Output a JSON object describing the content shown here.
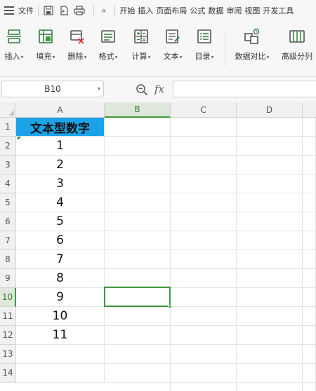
{
  "menubar": {
    "file_label": "文件",
    "tabs": [
      "开始",
      "插入",
      "页面布局",
      "公式",
      "数据",
      "审阅",
      "视图",
      "开发工具"
    ],
    "more_glyph": "»"
  },
  "ribbon": {
    "buttons": [
      {
        "label": "插入",
        "icon": "insert-icon"
      },
      {
        "label": "填充",
        "icon": "fill-icon"
      },
      {
        "label": "删除",
        "icon": "delete-icon"
      },
      {
        "label": "格式",
        "icon": "format-icon"
      },
      {
        "label": "计算",
        "icon": "calculate-icon"
      },
      {
        "label": "文本",
        "icon": "text-icon"
      },
      {
        "label": "目录",
        "icon": "catalog-icon"
      },
      {
        "label": "数据对比",
        "icon": "data-compare-icon"
      },
      {
        "label": "高级分列",
        "icon": "advanced-split-icon"
      }
    ],
    "caret": "▾"
  },
  "formula_bar": {
    "name_box": "B10",
    "fx_label": "fx",
    "value": ""
  },
  "grid": {
    "columns": [
      "A",
      "B",
      "C",
      "D"
    ],
    "selected_column": "B",
    "rows": [
      "1",
      "2",
      "3",
      "4",
      "5",
      "6",
      "7",
      "8",
      "9",
      "10",
      "11",
      "12",
      "13",
      "14"
    ],
    "selected_row": "10",
    "column_a": [
      "文本型数字",
      "1",
      "2",
      "3",
      "4",
      "5",
      "6",
      "7",
      "8",
      "9",
      "10",
      "11",
      "",
      ""
    ]
  },
  "colors": {
    "header_fill": "#1aa3e8",
    "selection": "#3c9a3c",
    "text_number_marker": "#1a8a3a"
  }
}
